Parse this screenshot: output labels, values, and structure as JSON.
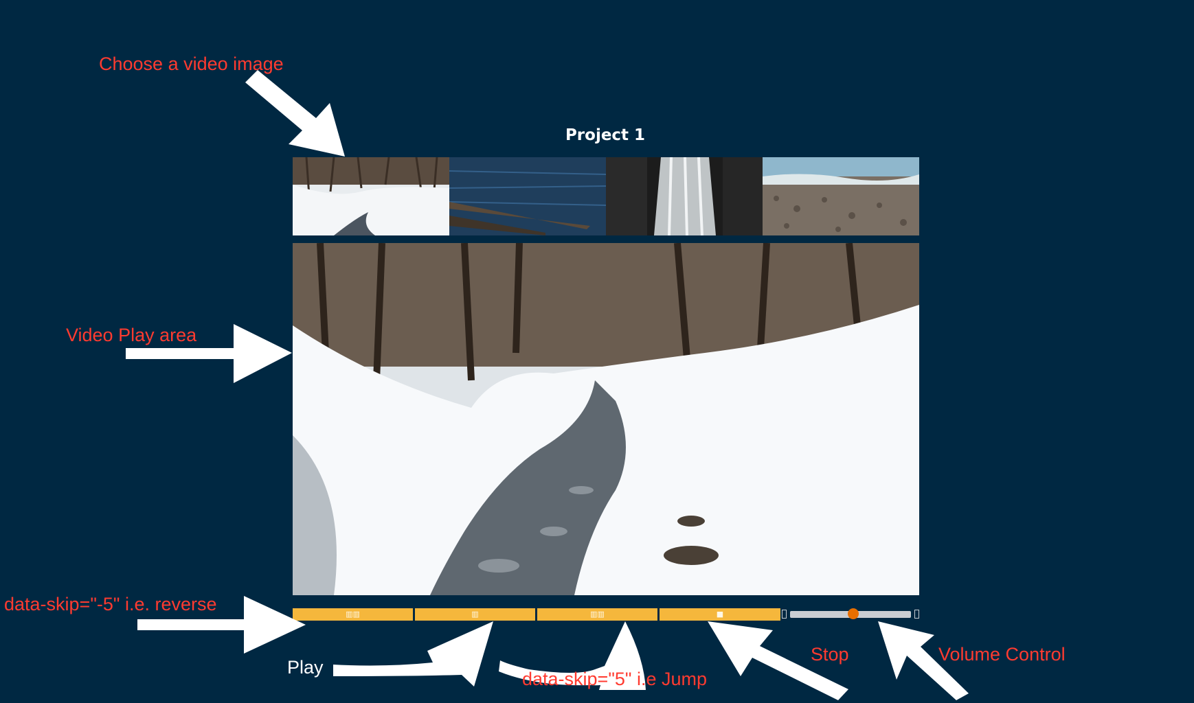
{
  "header": {
    "title": "Project 1"
  },
  "thumbnails": [
    {
      "name": "snowy-creek-thumbnail"
    },
    {
      "name": "river-log-thumbnail"
    },
    {
      "name": "waterfall-thumbnail"
    },
    {
      "name": "pebble-beach-thumbnail"
    }
  ],
  "controls": {
    "reverse_glyph": "▥▥",
    "play_glyph": "▥",
    "jump_glyph": "▥▥",
    "stop_glyph": "■",
    "volume_level": 0.52
  },
  "annotations": {
    "choose": "Choose a video image",
    "video_area": "Video Play area",
    "reverse": "data-skip=\"-5\" i.e. reverse",
    "play": "Play",
    "jump": "data-skip=\"5\" i.e Jump",
    "stop": "Stop",
    "volume": "Volume Control"
  },
  "colors": {
    "background": "#002842",
    "control_bar": "#f5b73c",
    "volume_thumb": "#e76f00",
    "annotation_red": "#ff3b30"
  }
}
